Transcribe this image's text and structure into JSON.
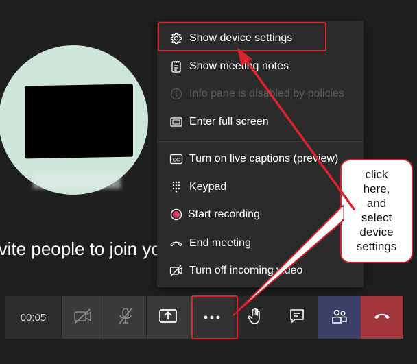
{
  "menu": {
    "items": [
      {
        "label": "Show device settings",
        "icon": "gear-icon",
        "enabled": true
      },
      {
        "label": "Show meeting notes",
        "icon": "notes-icon",
        "enabled": true
      },
      {
        "label": "Info pane is disabled by policies",
        "icon": "info-icon",
        "enabled": false
      },
      {
        "label": "Enter full screen",
        "icon": "fullscreen-icon",
        "enabled": true
      },
      {
        "label": "Turn on live captions (preview)",
        "icon": "captions-icon",
        "enabled": true
      },
      {
        "label": "Keypad",
        "icon": "keypad-icon",
        "enabled": true
      },
      {
        "label": "Start recording",
        "icon": "record-icon",
        "enabled": true
      },
      {
        "label": "End meeting",
        "icon": "end-call-icon",
        "enabled": true
      },
      {
        "label": "Turn off incoming video",
        "icon": "video-off-icon",
        "enabled": true
      }
    ]
  },
  "stage": {
    "invite_text": "Invite people to join you"
  },
  "toolbar": {
    "timer": "00:05",
    "buttons": [
      "camera-off-icon",
      "mic-off-icon",
      "share-tray-icon",
      "more-options-icon",
      "raise-hand-icon",
      "chat-icon",
      "participants-icon",
      "hang-up-icon"
    ]
  },
  "annotation": {
    "callout_lines": [
      "click",
      "here,",
      "and",
      "select",
      "device",
      "settings"
    ],
    "color": "#d9232e"
  },
  "colors": {
    "background": "#1f1f1f",
    "menu": "#2b2b2b",
    "participants_active": "#3c3f68",
    "leave": "#a4373e",
    "record_dot": "#d23b5a"
  }
}
